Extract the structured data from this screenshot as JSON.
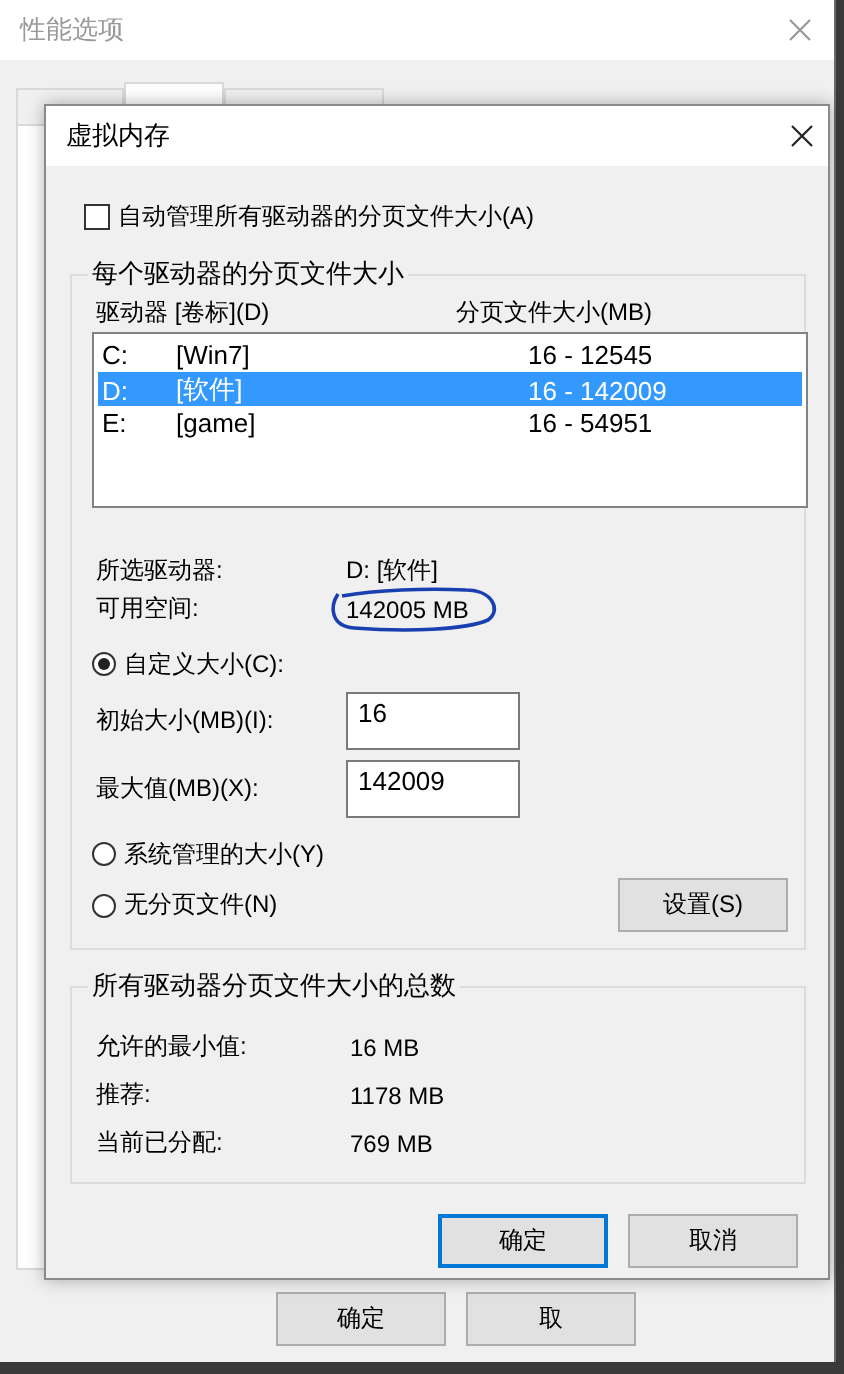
{
  "window": {
    "title": "性能选项",
    "tabs": [
      {
        "selected": false
      },
      {
        "selected": true
      },
      {
        "selected": false
      }
    ],
    "buttons": [
      "确定",
      "取"
    ]
  },
  "dialog": {
    "title": "虚拟内存",
    "auto_manage": {
      "label": "自动管理所有驱动器的分页文件大小(A)",
      "checked": false
    },
    "per_drive": {
      "title": "每个驱动器的分页文件大小",
      "columns": [
        "驱动器 [卷标](D)",
        "分页文件大小(MB)"
      ],
      "drives": [
        {
          "letter": "C:",
          "label": "[Win7]",
          "size": "16 - 12545",
          "selected": false
        },
        {
          "letter": "D:",
          "label": "[软件]",
          "size": "16 - 142009",
          "selected": true
        },
        {
          "letter": "E:",
          "label": "[game]",
          "size": "16 - 54951",
          "selected": false
        }
      ],
      "selected_drive": {
        "label": "所选驱动器:",
        "value": "D:  [软件]"
      },
      "free_space": {
        "label": "可用空间:",
        "value": "142005 MB",
        "circled": true
      },
      "size_options": [
        {
          "label": "自定义大小(C):",
          "selected": true
        },
        {
          "label": "系统管理的大小(Y)",
          "selected": false
        },
        {
          "label": "无分页文件(N)",
          "selected": false
        }
      ],
      "fields": [
        {
          "label": "初始大小(MB)(I):",
          "value": "16"
        },
        {
          "label": "最大值(MB)(X):",
          "value": "142009"
        }
      ],
      "set_button": "设置(S)"
    },
    "totals": {
      "title": "所有驱动器分页文件大小的总数",
      "rows": [
        {
          "label": "允许的最小值:",
          "value": "16 MB"
        },
        {
          "label": "推荐:",
          "value": "1178 MB"
        },
        {
          "label": "当前已分配:",
          "value": "769 MB"
        }
      ]
    },
    "buttons": [
      {
        "label": "确定",
        "focused": true
      },
      {
        "label": "取消",
        "focused": false
      }
    ]
  }
}
